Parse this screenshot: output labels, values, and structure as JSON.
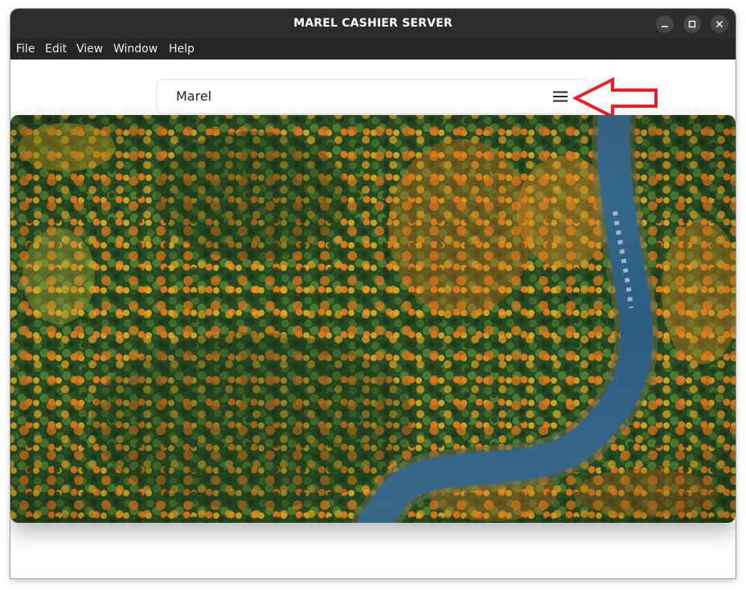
{
  "window": {
    "title": "MAREL CASHIER SERVER",
    "controls": {
      "minimize_icon": "minimize-icon",
      "maximize_icon": "maximize-icon",
      "close_icon": "close-icon"
    }
  },
  "menubar": {
    "items": [
      "File",
      "Edit",
      "View",
      "Window",
      "Help"
    ]
  },
  "navbar": {
    "brand": "Marel",
    "menu_icon": "hamburger-menu-icon"
  },
  "annotation": {
    "icon": "red-arrow-icon",
    "color": "#e8202a"
  },
  "hero": {
    "image": "aerial-autumn-forest-river",
    "colors": {
      "forest_dark": "#1f3a1c",
      "forest_green": "#3f6b2a",
      "autumn_orange": "#d9771d",
      "autumn_yellow": "#c9a321",
      "river": "#2c5d82"
    }
  },
  "theme": {
    "titlebar_bg": "#2c2c2c",
    "menubar_bg": "#262626",
    "accent_red": "#e8202a"
  }
}
